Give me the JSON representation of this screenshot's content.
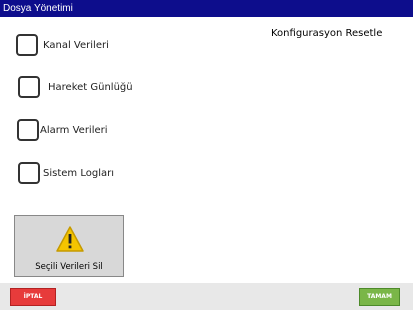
{
  "window": {
    "title": "Dosya Yönetimi"
  },
  "options": [
    {
      "label": "Kanal Verileri",
      "checked": false
    },
    {
      "label": "Hareket Günlüğü",
      "checked": false
    },
    {
      "label": "Alarm Verileri",
      "checked": false
    },
    {
      "label": "Sistem Logları",
      "checked": false
    }
  ],
  "reset": {
    "title": "Konfigurasyon Resetle"
  },
  "delete_button": {
    "label": "Seçili Verileri Sil",
    "icon": "warning-icon"
  },
  "footer": {
    "cancel_label": "İPTAL",
    "ok_label": "TAMAM"
  },
  "colors": {
    "titlebar": "#0d0d8c",
    "cancel": "#e73b3b",
    "ok": "#7ab648",
    "warning": "#f5c400"
  }
}
